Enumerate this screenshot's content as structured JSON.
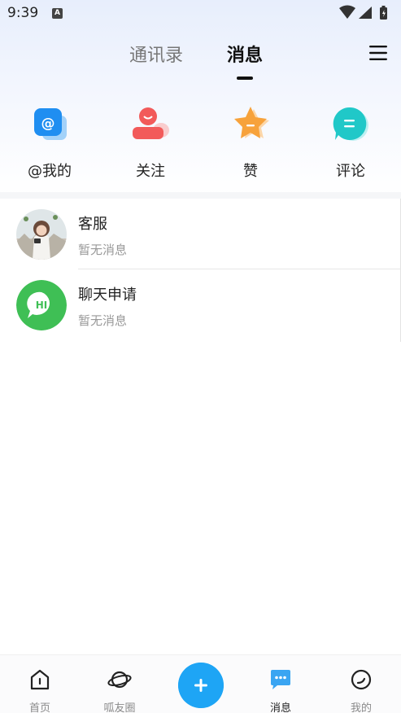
{
  "status_bar": {
    "time": "9:39",
    "notification_glyph": "A"
  },
  "header": {
    "tabs": [
      {
        "label": "通讯录",
        "active": false
      },
      {
        "label": "消息",
        "active": true
      }
    ],
    "menu_icon": "hamburger-menu-icon"
  },
  "quick_actions": [
    {
      "label": "@我的",
      "icon": "at-mention-icon",
      "color": "#1f8ef1"
    },
    {
      "label": "关注",
      "icon": "follow-person-icon",
      "color": "#f25a5a"
    },
    {
      "label": "赞",
      "icon": "star-like-icon",
      "color": "#f7a23b"
    },
    {
      "label": "评论",
      "icon": "comment-bubble-icon",
      "color": "#20c8c8"
    }
  ],
  "conversations": [
    {
      "title": "客服",
      "subtitle": "暂无消息",
      "avatar": "customer-service-avatar"
    },
    {
      "title": "聊天申请",
      "subtitle": "暂无消息",
      "avatar": "hi-chat-request-avatar",
      "avatar_text": "HI",
      "avatar_color": "#3fbf55"
    }
  ],
  "bottom_nav": {
    "items": [
      {
        "label": "首页",
        "icon": "home-icon",
        "active": false
      },
      {
        "label": "呱友圈",
        "icon": "planet-icon",
        "active": false
      },
      {
        "label": "",
        "icon": "plus-icon",
        "fab": true
      },
      {
        "label": "消息",
        "icon": "chat-bubble-icon",
        "active": true
      },
      {
        "label": "我的",
        "icon": "profile-icon",
        "active": false
      }
    ],
    "accent_color": "#1ea5f5"
  }
}
